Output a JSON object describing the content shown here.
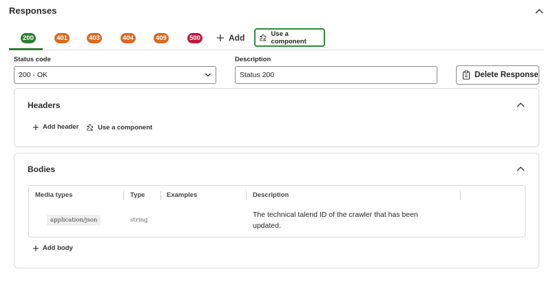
{
  "section": {
    "title": "Responses"
  },
  "tabs": [
    {
      "code": "200",
      "color": "#2e7d32",
      "selected": true
    },
    {
      "code": "401",
      "color": "#d96a1f"
    },
    {
      "code": "403",
      "color": "#d96a1f"
    },
    {
      "code": "404",
      "color": "#d96a1f"
    },
    {
      "code": "409",
      "color": "#d96a1f"
    },
    {
      "code": "500",
      "color": "#c0183f"
    }
  ],
  "tab_actions": {
    "add_label": "Add",
    "use_component_label": "Use a component"
  },
  "form": {
    "status_code_label": "Status code",
    "status_code_value": "200 - OK",
    "description_label": "Description",
    "description_value": "Status 200",
    "delete_label": "Delete Response"
  },
  "headers_panel": {
    "title": "Headers",
    "add_label": "Add header",
    "use_component_label": "Use a component"
  },
  "bodies_panel": {
    "title": "Bodies",
    "columns": [
      "Media types",
      "Type",
      "Examples",
      "Description"
    ],
    "rows": [
      {
        "media_type": "application/json",
        "type": "string",
        "examples": "",
        "description": "The technical talend ID of the crawler that has been updated."
      }
    ],
    "add_label": "Add body"
  },
  "colors": {
    "accent": "#2e7d32",
    "warning": "#d96a1f",
    "error": "#c0183f"
  }
}
